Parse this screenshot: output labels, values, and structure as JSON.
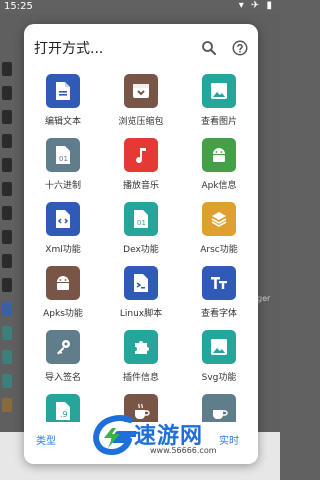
{
  "statusbar": {
    "time": "15:25",
    "icons_text": "▾ ✈ ▮"
  },
  "background": {
    "right_text": "ger"
  },
  "dialog": {
    "title": "打开方式...",
    "icons": {
      "search": "search-icon",
      "help": "help-icon"
    },
    "items": [
      {
        "label": "编辑文本",
        "color": "#2f5bb7",
        "icon": "file-text-icon"
      },
      {
        "label": "浏览压缩包",
        "color": "#795548",
        "icon": "archive-box-icon"
      },
      {
        "label": "查看图片",
        "color": "#26a69a",
        "icon": "image-icon"
      },
      {
        "label": "十六进制",
        "color": "#607d8b",
        "icon": "hex-file-icon"
      },
      {
        "label": "播放音乐",
        "color": "#e53935",
        "icon": "music-note-icon"
      },
      {
        "label": "Apk信息",
        "color": "#43a047",
        "icon": "android-icon"
      },
      {
        "label": "Xml功能",
        "color": "#2f5bb7",
        "icon": "code-file-icon"
      },
      {
        "label": "Dex功能",
        "color": "#26a69a",
        "icon": "dex-file-icon"
      },
      {
        "label": "Arsc功能",
        "color": "#e0a030",
        "icon": "layers-icon"
      },
      {
        "label": "Apks功能",
        "color": "#795548",
        "icon": "android-icon"
      },
      {
        "label": "Linux脚本",
        "color": "#2f5bb7",
        "icon": "terminal-icon"
      },
      {
        "label": "查看字体",
        "color": "#2f5bb7",
        "icon": "font-icon"
      },
      {
        "label": "导入签名",
        "color": "#607d8b",
        "icon": "key-icon"
      },
      {
        "label": "插件信息",
        "color": "#26a69a",
        "icon": "puzzle-icon"
      },
      {
        "label": "Svg功能",
        "color": "#26a69a",
        "icon": "image-icon"
      },
      {
        "label": "",
        "color": "#26a69a",
        "icon": "nine-patch-icon"
      },
      {
        "label": "",
        "color": "#795548",
        "icon": "coffee-icon"
      },
      {
        "label": "",
        "color": "#607d8b",
        "icon": "coffee-cup-icon"
      }
    ],
    "bottom": {
      "left": "类型",
      "right": "实时"
    }
  },
  "watermark": {
    "text": "速游网",
    "url": "www.56666.com",
    "color": "#1e6fd9"
  }
}
